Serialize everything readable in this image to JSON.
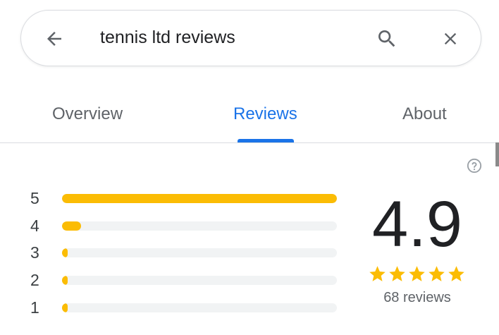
{
  "search": {
    "query": "tennis ltd reviews",
    "back_icon": "arrow-left-icon",
    "search_icon": "magnifier-icon",
    "clear_icon": "close-x-icon"
  },
  "tabs": [
    {
      "label": "Overview",
      "active": false
    },
    {
      "label": "Reviews",
      "active": true
    },
    {
      "label": "About",
      "active": false
    }
  ],
  "colors": {
    "accent": "#1a73e8",
    "bar_fill": "#fbbc04",
    "bar_track": "#f1f3f4",
    "star": "#fbbc04"
  },
  "reviews": {
    "help_icon": "question-circle-icon",
    "rating": "4.9",
    "stars": 5,
    "count_label": "68 reviews",
    "histogram": [
      {
        "label": "5",
        "fraction": 1.0
      },
      {
        "label": "4",
        "fraction": 0.07
      },
      {
        "label": "3",
        "fraction": 0.02
      },
      {
        "label": "2",
        "fraction": 0.005
      },
      {
        "label": "1",
        "fraction": 0.02
      }
    ]
  }
}
